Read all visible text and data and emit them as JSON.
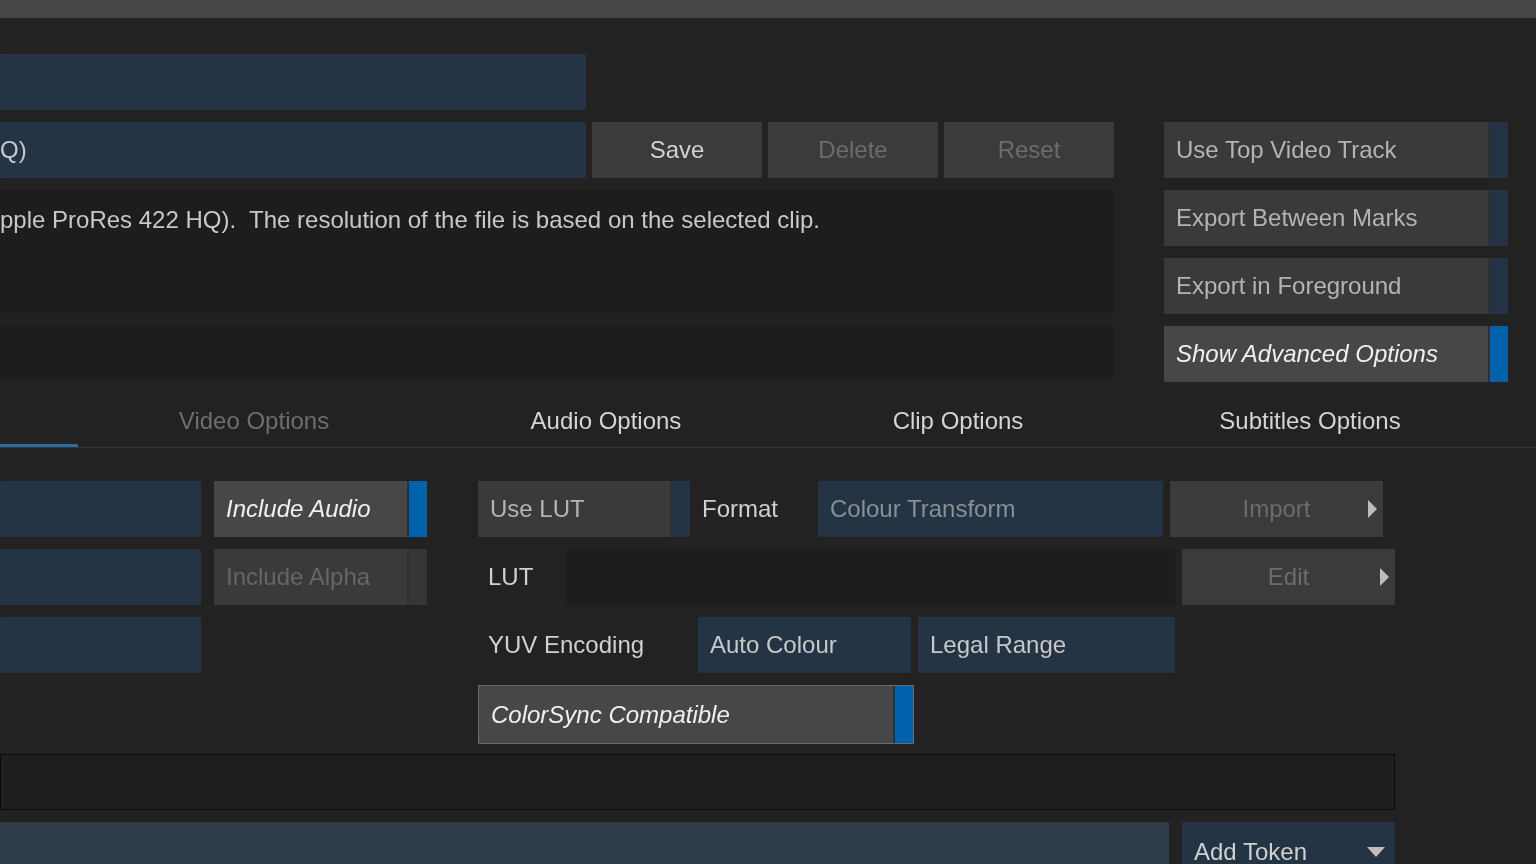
{
  "preset": {
    "value": "Q)"
  },
  "preset_buttons": [
    {
      "label": "Save",
      "disabled": false
    },
    {
      "label": "Delete",
      "disabled": true
    },
    {
      "label": "Reset",
      "disabled": true
    }
  ],
  "description": "pple ProRes 422 HQ).  The resolution of the file is based on the selected clip.",
  "export_toggles": [
    {
      "label": "Use Top Video Track",
      "checked": false
    },
    {
      "label": "Export Between Marks",
      "checked": false
    },
    {
      "label": "Export in Foreground",
      "checked": false
    },
    {
      "label": "Show Advanced Options",
      "checked": true
    }
  ],
  "tabs": [
    {
      "selected": true
    },
    {
      "label": "Video Options",
      "selected": false,
      "disabled": true
    },
    {
      "label": "Audio Options",
      "selected": false,
      "disabled": false
    },
    {
      "label": "Clip Options",
      "selected": false,
      "disabled": false
    },
    {
      "label": "Subtitles Options",
      "selected": false,
      "disabled": false
    }
  ],
  "audio_toggles": [
    {
      "label": "Include Audio",
      "checked": true,
      "disabled": false
    },
    {
      "label": "Include Alpha",
      "checked": false,
      "disabled": true
    }
  ],
  "lut": {
    "use_lut": {
      "label": "Use LUT",
      "checked": false
    },
    "format_label": "Format",
    "format_dropdown": {
      "placeholder": "Colour Transform"
    },
    "import_button": {
      "label": "Import",
      "disabled": true
    },
    "lut_label": "LUT",
    "edit_button": {
      "label": "Edit",
      "disabled": true
    }
  },
  "yuv": {
    "label": "YUV Encoding",
    "encoding": "Auto Colour",
    "range": "Legal Range"
  },
  "colorsync": {
    "label": "ColorSync Compatible",
    "checked": true
  },
  "add_token": {
    "label": "Add Token"
  }
}
